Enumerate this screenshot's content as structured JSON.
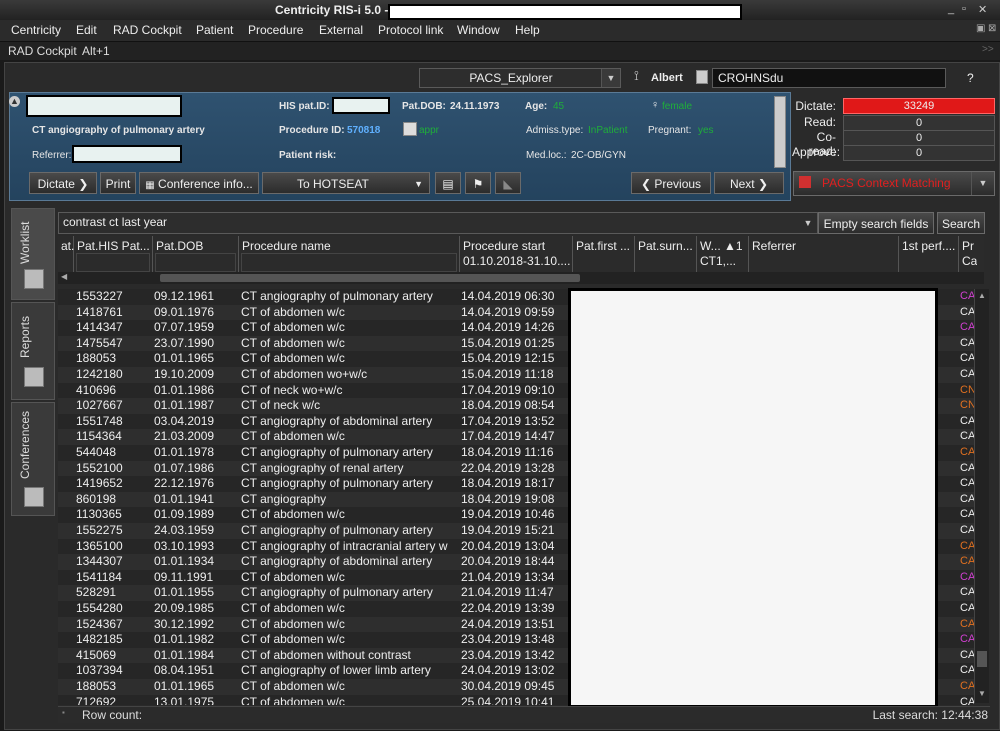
{
  "window": {
    "title": "Centricity RIS-i 5.0 -"
  },
  "menu": [
    "Centricity",
    "Edit",
    "RAD Cockpit",
    "Patient",
    "Procedure",
    "External",
    "Protocol link",
    "Window",
    "Help"
  ],
  "subbar": {
    "label": "RAD Cockpit",
    "shortcut": "Alt+1"
  },
  "toolbar": {
    "pacs_combo": "PACS_Explorer",
    "user": "Albert",
    "search_value": "CROHNSdu",
    "help": "?"
  },
  "patient": {
    "procedure": "CT angiography of pulmonary artery",
    "referrer_label": "Referrer:",
    "his_label": "HIS pat.ID:",
    "dob_label": "Pat.DOB:",
    "dob": "24.11.1973",
    "age_label": "Age:",
    "age": "45",
    "sex": "female",
    "procid_label": "Procedure ID:",
    "procid": "570818",
    "appr": "appr",
    "admiss_label": "Admiss.type:",
    "admiss": "InPatient",
    "pregnant_label": "Pregnant:",
    "pregnant": "yes",
    "risk_label": "Patient risk:",
    "medloc_label": "Med.loc.:",
    "medloc": "2C-OB/GYN"
  },
  "patient_buttons": {
    "dictate": "Dictate",
    "print": "Print",
    "conference": "Conference info...",
    "hotseat": "To HOTSEAT",
    "previous": "Previous",
    "next": "Next"
  },
  "stats": {
    "dictate_label": "Dictate:",
    "dictate": "33249",
    "read_label": "Read:",
    "read": "0",
    "coread_label": "Co-read:",
    "coread": "0",
    "approve_label": "Approve:",
    "approve": "0"
  },
  "pacs_matching": "PACS Context Matching",
  "tabs": {
    "worklist": "Worklist",
    "reports": "Reports",
    "conferences": "Conferences"
  },
  "search": {
    "query": "contrast ct last year",
    "empty_btn": "Empty search fields",
    "search_btn": "Search"
  },
  "columns": {
    "c0": "at.",
    "c1": "Pat.HIS Pat...",
    "c2": "Pat.DOB",
    "c3": "Procedure name",
    "c4": "Procedure start",
    "c4b": "01.10.2018-31.10....",
    "c5": "Pat.first ...",
    "c6": "Pat.surn...",
    "c7": "W... ▲1",
    "c7b": "CT1,...",
    "c8": "Referrer",
    "c9": "1st perf....",
    "c10": "Pr",
    "c10b": "Ca"
  },
  "rows": [
    {
      "id": "1553227",
      "dob": "09.12.1961",
      "proc": "CT angiography of pulmonary artery",
      "start": "14.04.2019 06:30",
      "tail": "CA",
      "tc": "#d040d0"
    },
    {
      "id": "1418761",
      "dob": "09.01.1976",
      "proc": "CT of abdomen w/c",
      "start": "14.04.2019 09:59",
      "tail": "CA",
      "tc": "#eeeeee"
    },
    {
      "id": "1414347",
      "dob": "07.07.1959",
      "proc": "CT of abdomen w/c",
      "start": "14.04.2019 14:26",
      "tail": "CA",
      "tc": "#d040d0"
    },
    {
      "id": "1475547",
      "dob": "23.07.1990",
      "proc": "CT of abdomen w/c",
      "start": "15.04.2019 01:25",
      "tail": "CA",
      "tc": "#eeeeee"
    },
    {
      "id": "188053",
      "dob": "01.01.1965",
      "proc": "CT of abdomen w/c",
      "start": "15.04.2019 12:15",
      "tail": "CA",
      "tc": "#eeeeee"
    },
    {
      "id": "1242180",
      "dob": "19.10.2009",
      "proc": "CT of abdomen wo+w/c",
      "start": "15.04.2019 11:18",
      "tail": "CA",
      "tc": "#eeeeee"
    },
    {
      "id": "410696",
      "dob": "01.01.1986",
      "proc": "CT of neck wo+w/c",
      "start": "17.04.2019 09:10",
      "tail": "CN",
      "tc": "#e07020"
    },
    {
      "id": "1027667",
      "dob": "01.01.1987",
      "proc": "CT of neck w/c",
      "start": "18.04.2019 08:54",
      "tail": "CN",
      "tc": "#e07020"
    },
    {
      "id": "1551748",
      "dob": "03.04.2019",
      "proc": "CT angiography of abdominal artery",
      "start": "17.04.2019 13:52",
      "tail": "CA",
      "tc": "#eeeeee"
    },
    {
      "id": "1154364",
      "dob": "21.03.2009",
      "proc": "CT of abdomen w/c",
      "start": "17.04.2019 14:47",
      "tail": "CA",
      "tc": "#eeeeee"
    },
    {
      "id": "544048",
      "dob": "01.01.1978",
      "proc": "CT angiography of pulmonary artery",
      "start": "18.04.2019 11:16",
      "tail": "CA",
      "tc": "#e07020"
    },
    {
      "id": "1552100",
      "dob": "01.07.1986",
      "proc": "CT angiography of renal artery",
      "start": "22.04.2019 13:28",
      "tail": "CA",
      "tc": "#eeeeee"
    },
    {
      "id": "1419652",
      "dob": "22.12.1976",
      "proc": "CT angiography of pulmonary artery",
      "start": "18.04.2019 18:17",
      "tail": "CA",
      "tc": "#eeeeee"
    },
    {
      "id": "860198",
      "dob": "01.01.1941",
      "proc": "CT angiography",
      "start": "18.04.2019 19:08",
      "tail": "CA",
      "tc": "#eeeeee"
    },
    {
      "id": "1130365",
      "dob": "01.09.1989",
      "proc": "CT of abdomen w/c",
      "start": "19.04.2019 10:46",
      "tail": "CA",
      "tc": "#eeeeee"
    },
    {
      "id": "1552275",
      "dob": "24.03.1959",
      "proc": "CT angiography of pulmonary artery",
      "start": "19.04.2019 15:21",
      "tail": "CA",
      "tc": "#eeeeee"
    },
    {
      "id": "1365100",
      "dob": "03.10.1993",
      "proc": "CT angiography of intracranial artery w",
      "start": "20.04.2019 13:04",
      "tail": "CA",
      "tc": "#e07020"
    },
    {
      "id": "1344307",
      "dob": "01.01.1934",
      "proc": "CT angiography of abdominal artery",
      "start": "20.04.2019 18:44",
      "tail": "CA",
      "tc": "#e07020"
    },
    {
      "id": "1541184",
      "dob": "09.11.1991",
      "proc": "CT of abdomen w/c",
      "start": "21.04.2019 13:34",
      "tail": "CA",
      "tc": "#d040d0"
    },
    {
      "id": "528291",
      "dob": "01.01.1955",
      "proc": "CT angiography of pulmonary artery",
      "start": "21.04.2019 11:47",
      "tail": "CA",
      "tc": "#eeeeee"
    },
    {
      "id": "1554280",
      "dob": "20.09.1985",
      "proc": "CT of abdomen w/c",
      "start": "22.04.2019 13:39",
      "tail": "CA",
      "tc": "#eeeeee"
    },
    {
      "id": "1524367",
      "dob": "30.12.1992",
      "proc": "CT of abdomen w/c",
      "start": "24.04.2019 13:51",
      "tail": "CA",
      "tc": "#e07020"
    },
    {
      "id": "1482185",
      "dob": "01.01.1982",
      "proc": "CT of abdomen w/c",
      "start": "23.04.2019 13:48",
      "tail": "CA",
      "tc": "#d040d0"
    },
    {
      "id": "415069",
      "dob": "01.01.1984",
      "proc": "CT of abdomen without contrast",
      "start": "23.04.2019 13:42",
      "tail": "CA",
      "tc": "#eeeeee"
    },
    {
      "id": "1037394",
      "dob": "08.04.1951",
      "proc": "CT angiography of lower limb artery",
      "start": "24.04.2019 13:02",
      "tail": "CA",
      "tc": "#eeeeee"
    },
    {
      "id": "188053",
      "dob": "01.01.1965",
      "proc": "CT of abdomen w/c",
      "start": "30.04.2019 09:45",
      "tail": "CA",
      "tc": "#e07020"
    },
    {
      "id": "712692",
      "dob": "13.01.1975",
      "proc": "CT of abdomen w/c",
      "start": "25.04.2019 10:41",
      "tail": "CA",
      "tc": "#eeeeee"
    }
  ],
  "status": {
    "rowcount_label": "Row count:",
    "lastsearch": "Last search: 12:44:38"
  },
  "colors": {
    "dictate_red": "#e01818",
    "pacs_red": "#e02020",
    "panel_blue": "#2f5270",
    "green_text": "#1fae3a"
  }
}
